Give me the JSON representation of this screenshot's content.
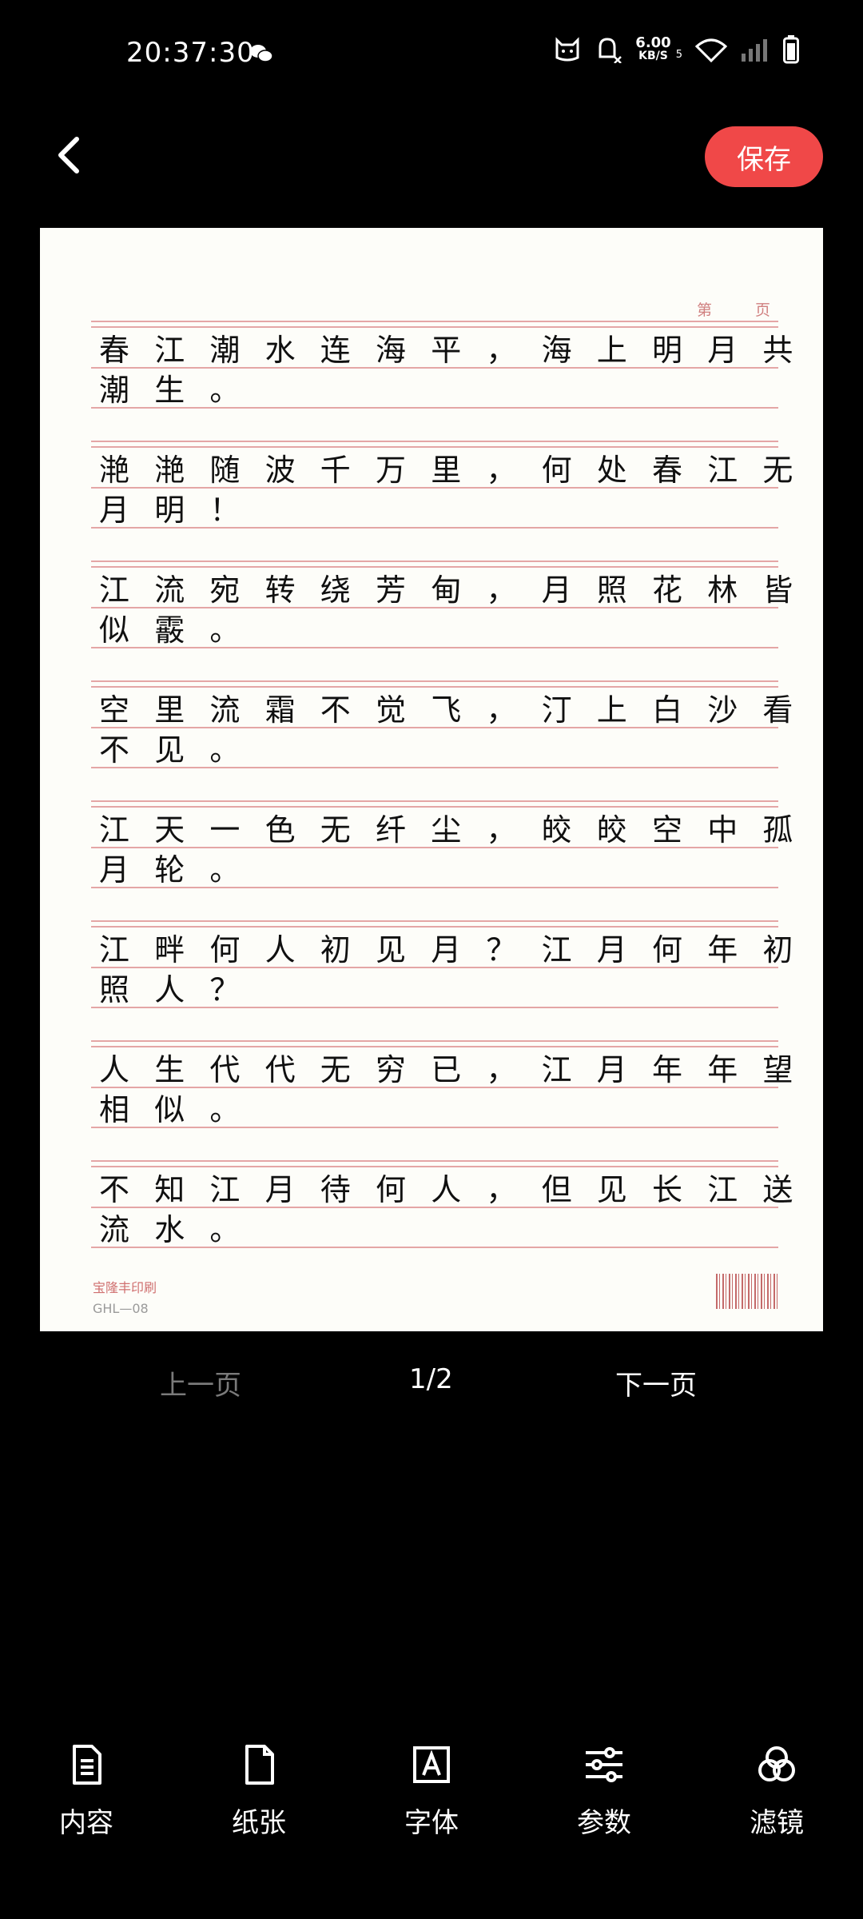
{
  "status_bar": {
    "time": "20:37:30",
    "net_speed_value": "6.00",
    "net_speed_unit": "KB/S",
    "signal_badge": "5"
  },
  "header": {
    "save_label": "保存"
  },
  "paper": {
    "page_label": "第页",
    "publisher": "宝隆丰印刷",
    "code": "GHL—08",
    "lines": [
      {
        "l1": "春江潮水连海平，海上明月共",
        "l2": "潮生。"
      },
      {
        "l1": "滟滟随波千万里，何处春江无",
        "l2": "月明！"
      },
      {
        "l1": "江流宛转绕芳甸，月照花林皆",
        "l2": "似霰。"
      },
      {
        "l1": "空里流霜不觉飞，汀上白沙看",
        "l2": "不见。"
      },
      {
        "l1": "江天一色无纤尘，皎皎空中孤",
        "l2": "月轮。"
      },
      {
        "l1": "江畔何人初见月？江月何年初",
        "l2": "照人？"
      },
      {
        "l1": "人生代代无穷已，江月年年望",
        "l2": "相似。"
      },
      {
        "l1": "不知江月待何人，但见长江送",
        "l2": "流水。"
      }
    ]
  },
  "pager": {
    "prev_label": "上一页",
    "page_indicator": "1/2",
    "next_label": "下一页"
  },
  "toolbar": {
    "content_label": "内容",
    "paper_label": "纸张",
    "font_label": "字体",
    "params_label": "参数",
    "filter_label": "滤镜"
  }
}
